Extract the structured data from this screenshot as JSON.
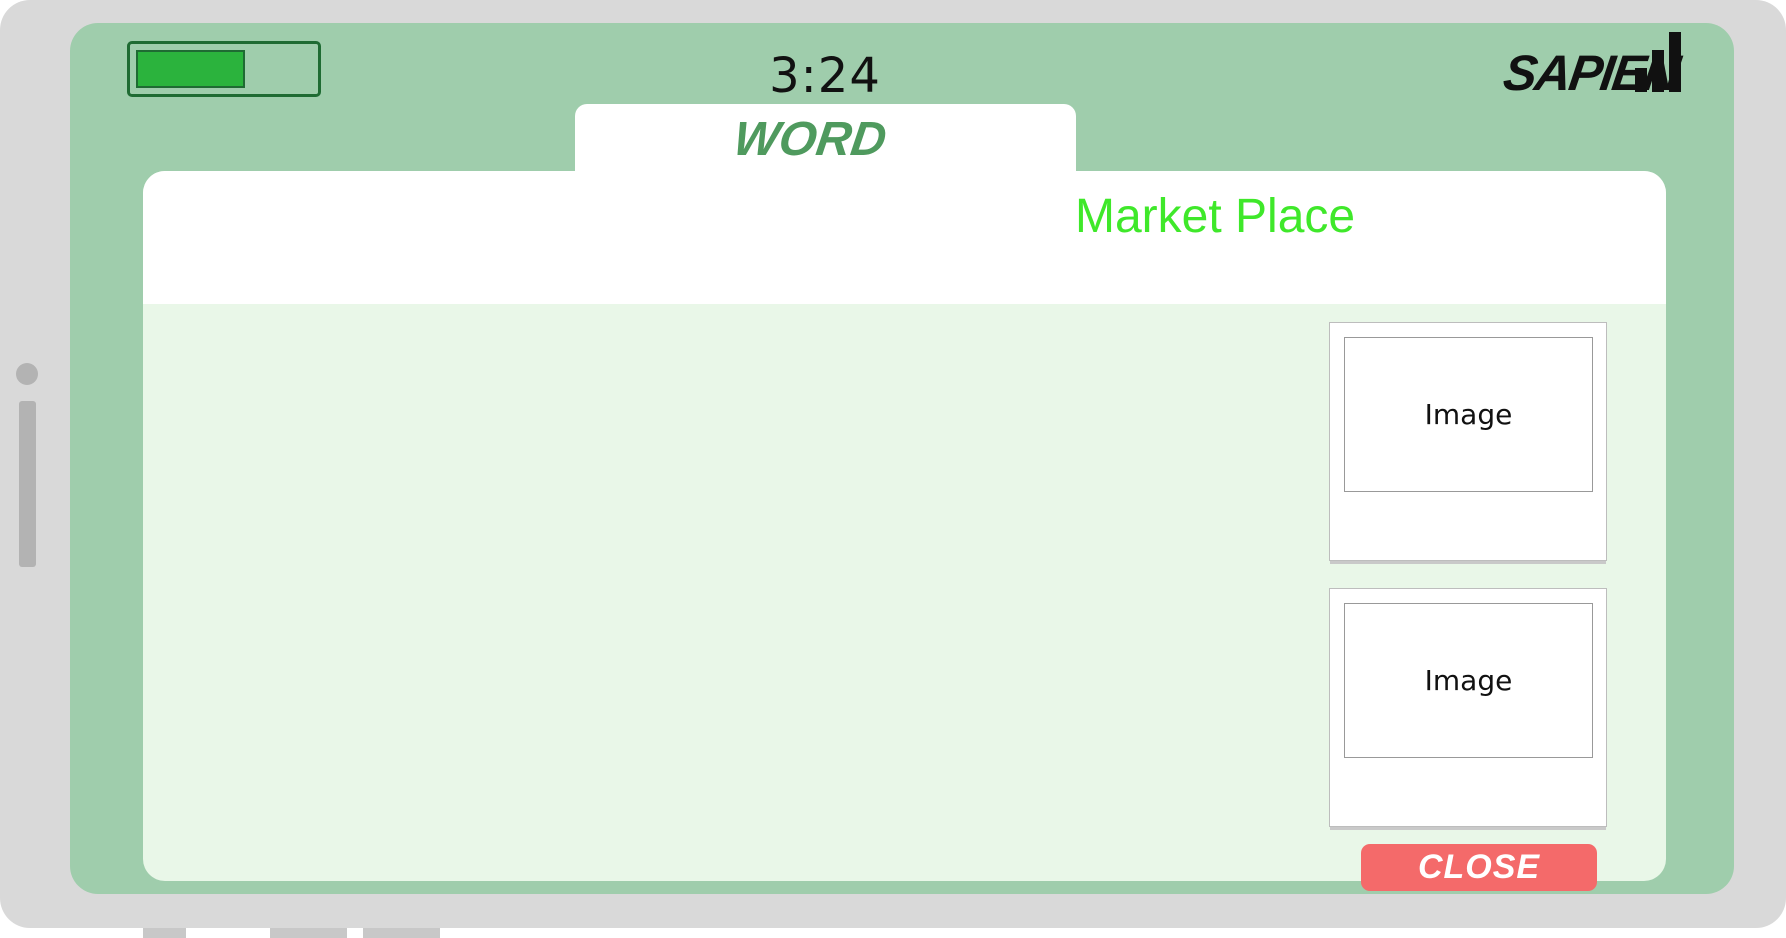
{
  "status_bar": {
    "battery_level": 0.62,
    "time": "3:24",
    "brand": "SAPIEN",
    "signal_icon": "signal-bars-icon"
  },
  "tab": {
    "label": "WORD"
  },
  "panel": {
    "title": "Market Place",
    "cards": [
      {
        "image_label": "Image"
      },
      {
        "image_label": "Image"
      }
    ]
  },
  "close_button": {
    "label": "CLOSE"
  },
  "colors": {
    "screen_bg": "#9fcdac",
    "panel_bg": "#e9f7e8",
    "title": "#3fe82a",
    "tab_label": "#4f9a5e",
    "battery": "#2bb33d",
    "close": "#f46a6a"
  }
}
